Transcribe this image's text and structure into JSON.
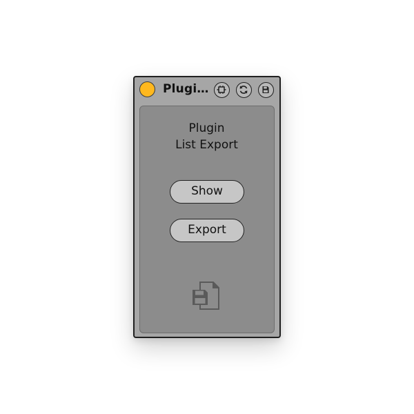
{
  "device": {
    "title": "Plugi…",
    "power_color": "#ffb81e",
    "titlebar_icons": [
      "map-icon",
      "refresh-icon",
      "save-preset-icon"
    ]
  },
  "panel": {
    "heading_line1": "Plugin",
    "heading_line2": "List Export",
    "show_label": "Show",
    "export_label": "Export",
    "footer_icon": "file-save-icon"
  }
}
